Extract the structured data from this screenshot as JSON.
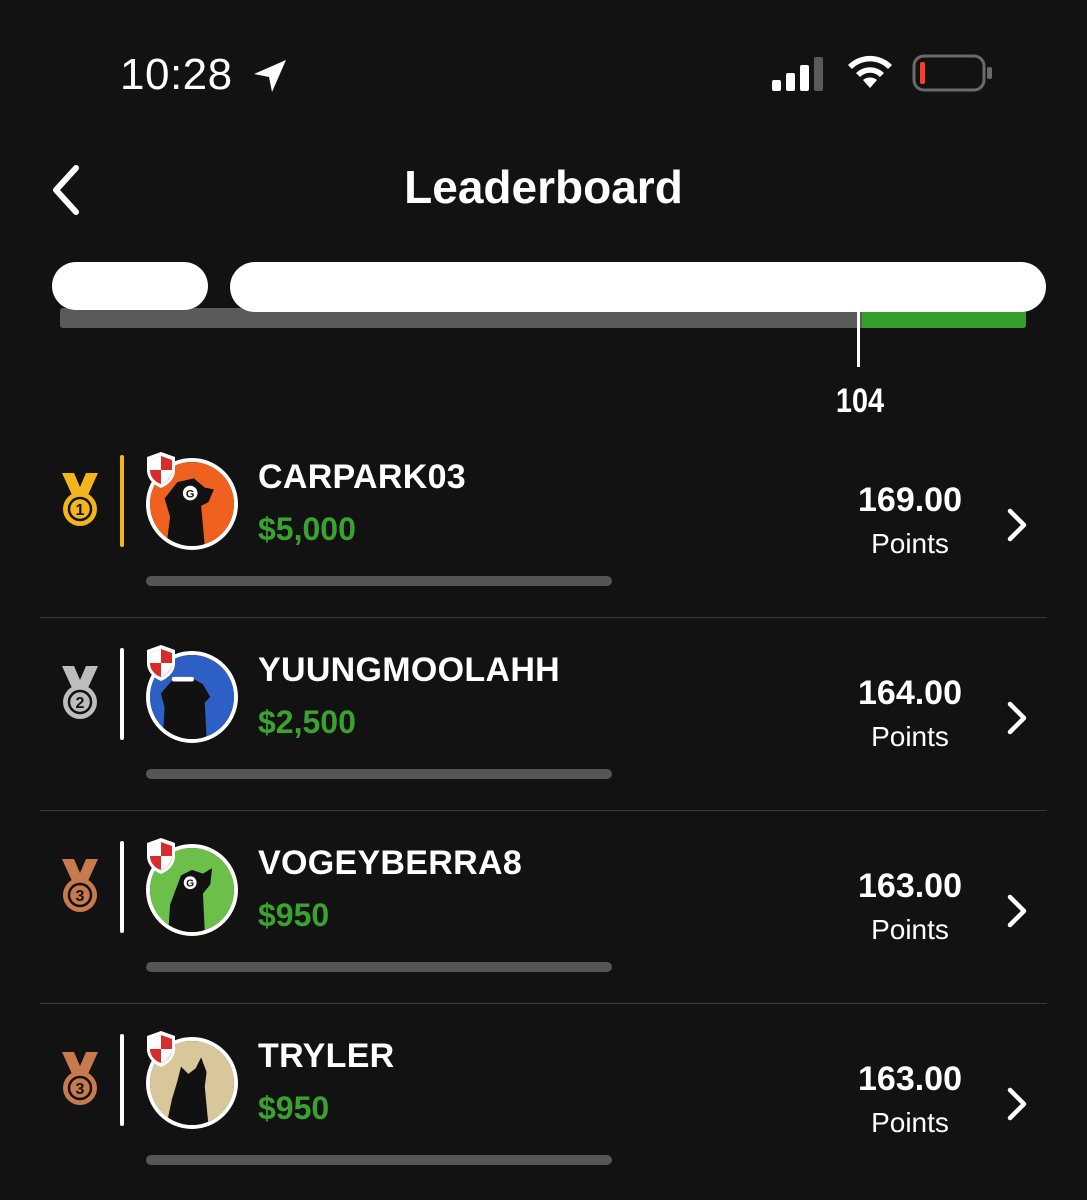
{
  "status_bar": {
    "time": "10:28",
    "icons": [
      "location-arrow-icon",
      "cellular-signal-icon",
      "wifi-icon",
      "battery-low-icon"
    ]
  },
  "header": {
    "title": "Leaderboard",
    "back_icon": "chevron-left-icon"
  },
  "cut_line": {
    "marker_value": "104",
    "colors": {
      "track": "#5a5a5a",
      "fill": "#34a02b"
    }
  },
  "leaderboard": [
    {
      "rank": "1",
      "medal": "gold",
      "username": "CARPARK03",
      "prize": "$5,000",
      "points": "169.00",
      "points_label": "Points",
      "avatar_bg": "#f0601e",
      "avatar_letter": "G"
    },
    {
      "rank": "2",
      "medal": "silver",
      "username": "YUUNGMOOLAHH",
      "prize": "$2,500",
      "points": "164.00",
      "points_label": "Points",
      "avatar_bg": "#2d5fc4",
      "avatar_letter": ""
    },
    {
      "rank": "3",
      "medal": "bronze",
      "username": "VOGEYBERRA8",
      "prize": "$950",
      "points": "163.00",
      "points_label": "Points",
      "avatar_bg": "#6cc04a",
      "avatar_letter": "G"
    },
    {
      "rank": "3",
      "medal": "bronze",
      "username": "TRYLER",
      "prize": "$950",
      "points": "163.00",
      "points_label": "Points",
      "avatar_bg": "#d8c79a",
      "avatar_letter": ""
    }
  ],
  "colors": {
    "background": "#121212",
    "prize_green": "#3aa32f",
    "gold": "#f2b51b",
    "silver": "#bdbdbd",
    "bronze": "#c77a4e"
  }
}
